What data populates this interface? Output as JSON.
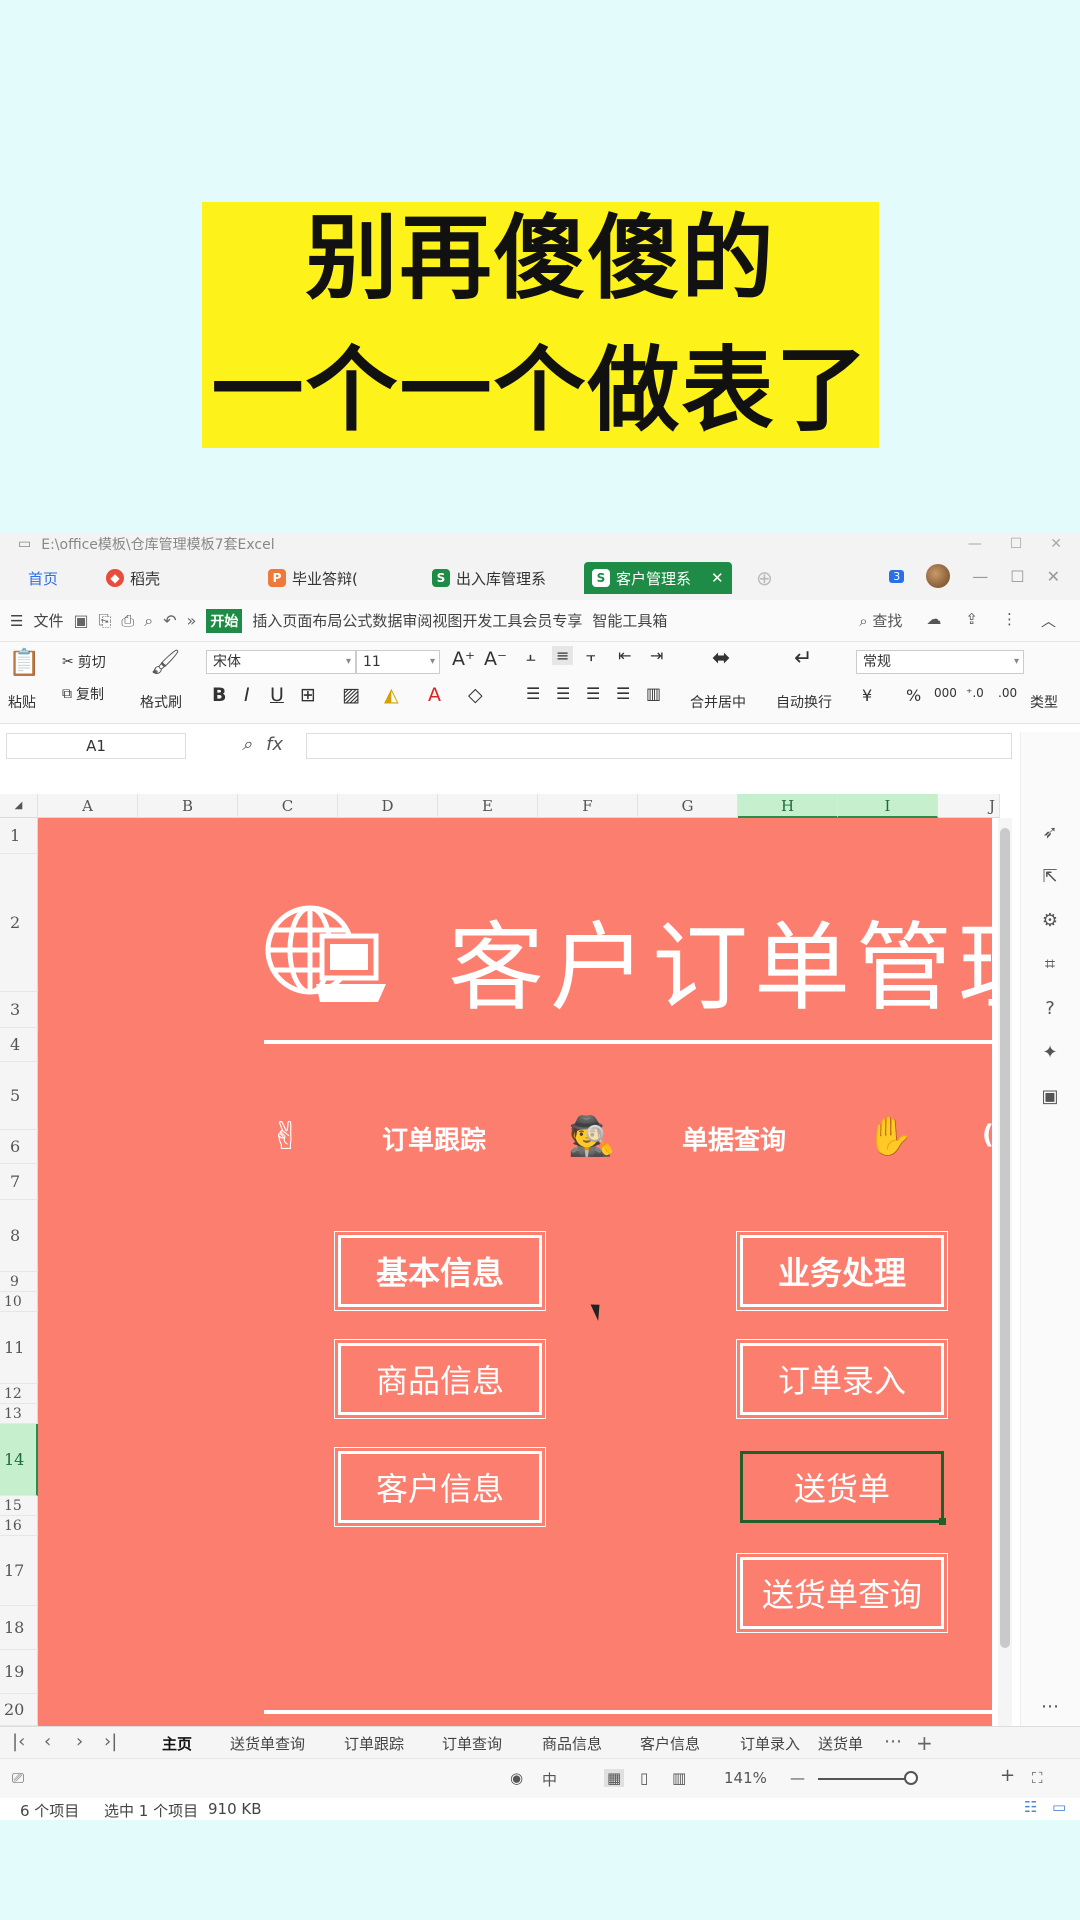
{
  "banner": {
    "line1": "别再傻傻的",
    "line2": "一个一个做表了"
  },
  "window": {
    "path": "E:\\office模板\\仓库管理模板7套Excel"
  },
  "tabs": [
    {
      "label": "首页"
    },
    {
      "label": "稻壳"
    },
    {
      "label": "毕业答辩("
    },
    {
      "label": "出入库管理系"
    },
    {
      "label": "客户管理系"
    }
  ],
  "menubar": {
    "file": "文件",
    "start": "开始",
    "items": "插入页面布局公式数据审阅视图开发工具会员专享",
    "smart": "智能工具箱",
    "search": "查找"
  },
  "ribbon": {
    "paste": "粘贴",
    "cut": "剪切",
    "copy": "复制",
    "format_painter": "格式刷",
    "font": "宋体",
    "size": "11",
    "merge": "合并居中",
    "wrap": "自动换行",
    "number_format": "常规",
    "type_conv": "类型"
  },
  "formula": {
    "cell_ref": "A1",
    "fx": "fx"
  },
  "columns": [
    "A",
    "B",
    "C",
    "D",
    "E",
    "F",
    "G",
    "H",
    "I",
    "J"
  ],
  "rows": [
    "1",
    "2",
    "3",
    "4",
    "5",
    "6",
    "7",
    "8",
    "9",
    "10",
    "11",
    "12",
    "13",
    "14",
    "15",
    "16",
    "17",
    "18",
    "19",
    "20"
  ],
  "dashboard": {
    "title": "客户订单管理",
    "nav": [
      "订单跟踪",
      "单据查询"
    ],
    "left": [
      "基本信息",
      "商品信息",
      "客户信息"
    ],
    "right": [
      "业务处理",
      "订单录入",
      "送货单",
      "送货单查询"
    ]
  },
  "sheet_tabs": [
    "主页",
    "送货单查询",
    "订单跟踪",
    "订单查询",
    "商品信息",
    "客户信息",
    "订单录入",
    "送货单"
  ],
  "status": {
    "zoom": "141%"
  },
  "explorer": {
    "count": "6 个项目",
    "selected": "选中 1 个项目",
    "size": "910 KB"
  },
  "colors": {
    "background": "#e3fbfa",
    "banner": "#fdf21a",
    "sheet_fill": "#fc7e6e",
    "accent": "#1e8c46"
  }
}
